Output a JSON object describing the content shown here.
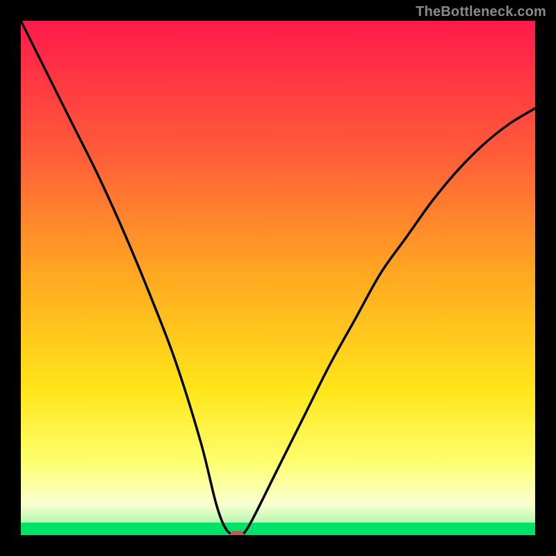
{
  "watermark": "TheBottleneck.com",
  "chart_data": {
    "type": "line",
    "title": "",
    "xlabel": "",
    "ylabel": "",
    "xlim": [
      0,
      100
    ],
    "ylim": [
      0,
      100
    ],
    "grid": false,
    "legend": false,
    "gradient_stops": [
      {
        "offset": 0.0,
        "color": "#ff1a4b"
      },
      {
        "offset": 0.25,
        "color": "#ff5a3a"
      },
      {
        "offset": 0.5,
        "color": "#ffaa20"
      },
      {
        "offset": 0.72,
        "color": "#ffe61a"
      },
      {
        "offset": 0.86,
        "color": "#fdff70"
      },
      {
        "offset": 0.94,
        "color": "#f9ffd0"
      },
      {
        "offset": 0.975,
        "color": "#b7f7b0"
      },
      {
        "offset": 1.0,
        "color": "#00e268"
      }
    ],
    "series": [
      {
        "name": "bottleneck-curve",
        "x": [
          0,
          5,
          10,
          15,
          20,
          25,
          30,
          35,
          38,
          40,
          42,
          43,
          45,
          50,
          55,
          60,
          65,
          70,
          75,
          80,
          85,
          90,
          95,
          100
        ],
        "values": [
          100,
          90,
          80,
          70,
          59,
          47,
          34,
          18,
          6,
          1,
          0,
          0,
          3,
          13,
          23,
          33,
          42,
          51,
          58,
          65,
          71,
          76,
          80,
          83
        ]
      }
    ],
    "marker": {
      "x": 42,
      "y": 0,
      "color": "#c05a54"
    }
  }
}
